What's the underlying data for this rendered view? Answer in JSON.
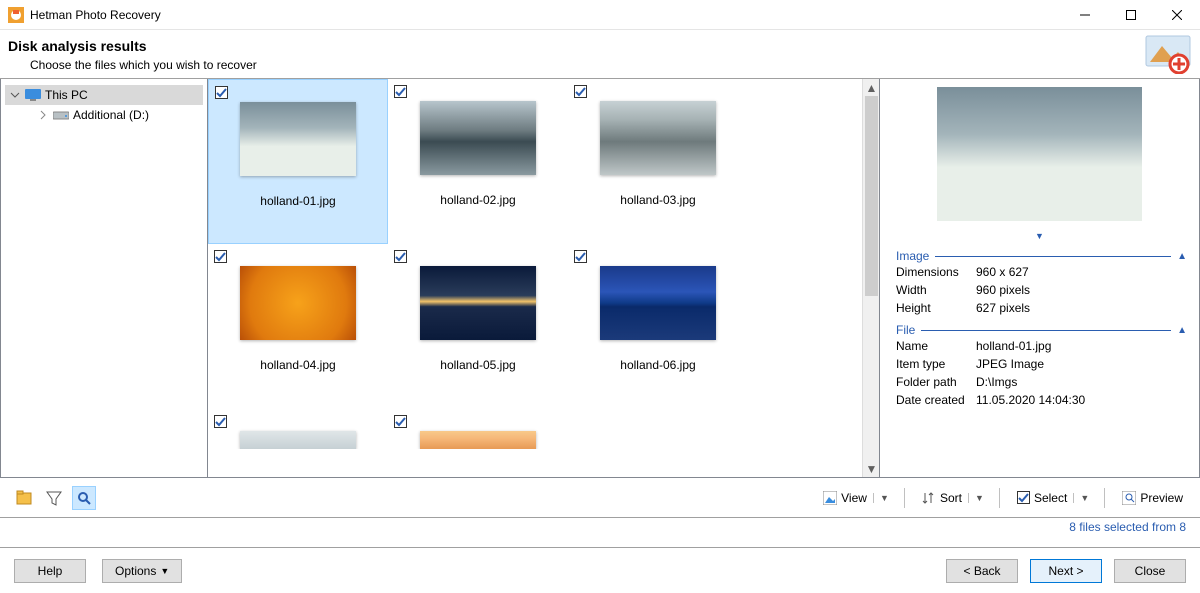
{
  "window": {
    "title": "Hetman Photo Recovery",
    "heading": "Disk analysis results",
    "subheading": "Choose the files which you wish to recover"
  },
  "tree": {
    "root": {
      "label": "This PC",
      "selected": true
    },
    "children": [
      {
        "label": "Additional (D:)"
      }
    ]
  },
  "thumbs": [
    {
      "label": "holland-01.jpg",
      "checked": true,
      "selected": true,
      "bg": "linear-gradient(to bottom,#7a8f9a 0%,#a3b4ba 35%,#e8efe9 60%,#e8efe9 100%)"
    },
    {
      "label": "holland-02.jpg",
      "checked": true,
      "selected": false,
      "bg": "linear-gradient(to bottom,#b7c5cc 0%,#6d7b80 40%,#3b4b52 55%,#8a9aa0 100%)"
    },
    {
      "label": "holland-03.jpg",
      "checked": true,
      "selected": false,
      "bg": "linear-gradient(to bottom,#c7d1d4 0%,#a6b2b4 25%,#6e7a7c 55%,#bfc7c8 100%)"
    },
    {
      "label": "holland-04.jpg",
      "checked": true,
      "selected": false,
      "bg": "radial-gradient(circle,#f7a21a 0%,#e07a0e 70%,#b94f07 100%)"
    },
    {
      "label": "holland-05.jpg",
      "checked": true,
      "selected": false,
      "bg": "linear-gradient(to bottom,#0a1a3a 0%,#2a3c5a 40%,#f3c46a 48%,#1a2a4a 55%,#0a1a3a 100%)"
    },
    {
      "label": "holland-06.jpg",
      "checked": true,
      "selected": false,
      "bg": "linear-gradient(to bottom,#1a3a8a 0%,#2b55b8 35%,#0f3a88 50%,#0a2a6a 55%,#1b3a7a 100%)"
    },
    {
      "label": "",
      "checked": true,
      "selected": false,
      "bg": "linear-gradient(to bottom,#e0e6e8 0%,#c6d0d4 100%)"
    },
    {
      "label": "",
      "checked": true,
      "selected": false,
      "bg": "linear-gradient(to bottom,#f8c98a 0%,#f6b879 40%,#e79a55 100%)"
    }
  ],
  "preview": {
    "bg": "linear-gradient(to bottom,#7a8f9a 0%,#a3b4ba 35%,#e8efe9 60%,#e8efe9 100%)"
  },
  "details": {
    "image": {
      "title": "Image",
      "props": [
        {
          "k": "Dimensions",
          "v": "960 x 627"
        },
        {
          "k": "Width",
          "v": "960 pixels"
        },
        {
          "k": "Height",
          "v": "627 pixels"
        }
      ]
    },
    "file": {
      "title": "File",
      "props": [
        {
          "k": "Name",
          "v": "holland-01.jpg"
        },
        {
          "k": "Item type",
          "v": "JPEG Image"
        },
        {
          "k": "Folder path",
          "v": "D:\\Imgs"
        },
        {
          "k": "Date created",
          "v": "11.05.2020 14:04:30"
        }
      ]
    }
  },
  "toolbar": {
    "view": "View",
    "sort": "Sort",
    "select": "Select",
    "preview": "Preview"
  },
  "status": "8 files selected from 8",
  "footer": {
    "help": "Help",
    "options": "Options",
    "back": "< Back",
    "next": "Next >",
    "close": "Close"
  }
}
